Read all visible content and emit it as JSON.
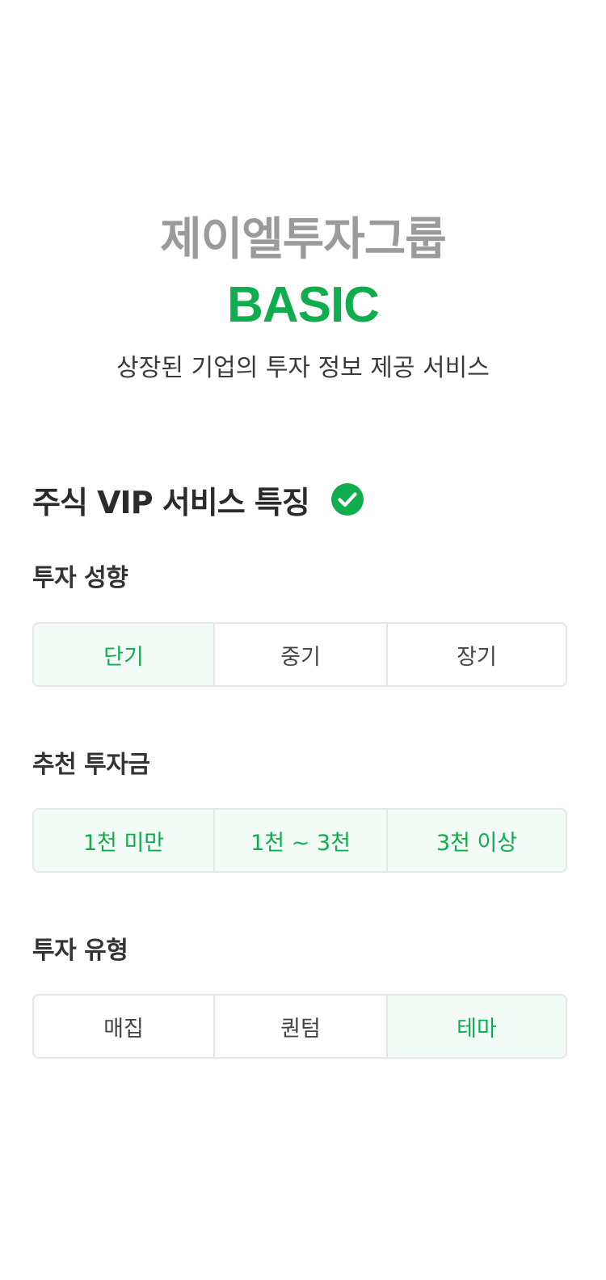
{
  "header": {
    "brand": "제이엘투자그룹",
    "plan": "BASIC",
    "subtitle": "상장된 기업의 투자 정보 제공 서비스"
  },
  "features": {
    "title": "주식 VIP 서비스 특징",
    "title_icon": "check-circle-icon",
    "accent_color": "#10ad4e"
  },
  "groups": [
    {
      "label": "투자 성향",
      "options": [
        {
          "label": "단기",
          "selected": true
        },
        {
          "label": "중기",
          "selected": false
        },
        {
          "label": "장기",
          "selected": false
        }
      ]
    },
    {
      "label": "추천 투자금",
      "options": [
        {
          "label": "1천 미만",
          "selected": true
        },
        {
          "label": "1천 ~ 3천",
          "selected": true
        },
        {
          "label": "3천 이상",
          "selected": true
        }
      ]
    },
    {
      "label": "투자 유형",
      "options": [
        {
          "label": "매집",
          "selected": false
        },
        {
          "label": "퀀텀",
          "selected": false
        },
        {
          "label": "테마",
          "selected": true
        }
      ]
    }
  ]
}
